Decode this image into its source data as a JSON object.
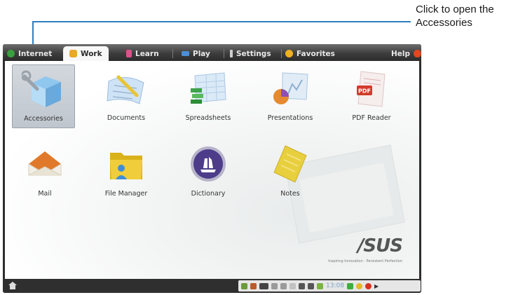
{
  "callout": {
    "line1": "Click to open the",
    "line2": "Accessories"
  },
  "tabs": [
    {
      "label": "Internet"
    },
    {
      "label": "Work"
    },
    {
      "label": "Learn"
    },
    {
      "label": "Play"
    },
    {
      "label": "Settings"
    },
    {
      "label": "Favorites"
    },
    {
      "label": "Help"
    }
  ],
  "apps": [
    {
      "label": "Accessories"
    },
    {
      "label": "Documents"
    },
    {
      "label": "Spreadsheets"
    },
    {
      "label": "Presentations"
    },
    {
      "label": "PDF Reader"
    },
    {
      "label": "Mail"
    },
    {
      "label": "File Manager"
    },
    {
      "label": "Dictionary"
    },
    {
      "label": "Notes"
    }
  ],
  "brand": {
    "name": "/SUS",
    "tagline": "Inspiring Innovation · Persistent Perfection"
  },
  "taskbar": {
    "clock": "13:08"
  },
  "colors": {
    "accent": "#2f7fc0",
    "active_tab": "#f7f7f7"
  }
}
